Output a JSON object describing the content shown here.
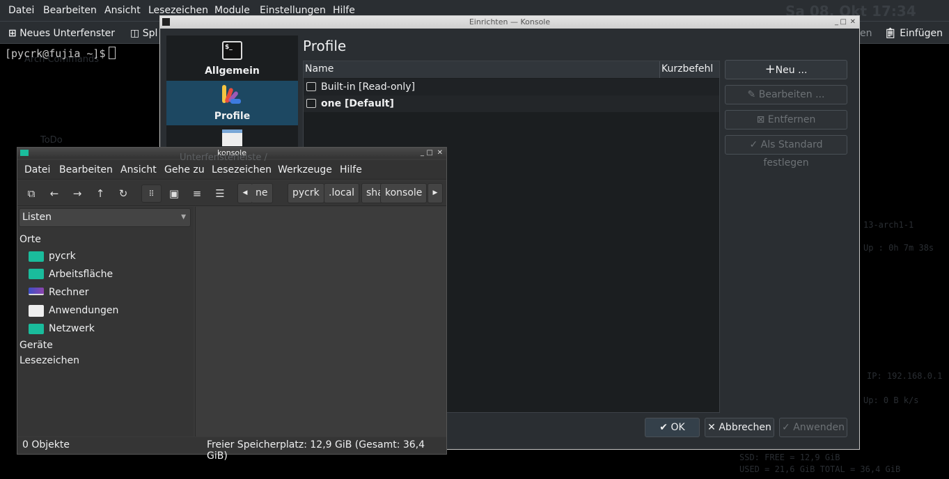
{
  "desktop": {
    "icons": [
      "Arch Commands",
      "ToDo",
      "Unterfensterleiste /"
    ],
    "conky": {
      "clock": "Sa 08. Okt 17:34",
      "kernel": "13-arch1-1",
      "uptime": "Up : 0h 7m 38s",
      "ip": "IP: 192.168.0.1",
      "net_up": "Up: 0 B k/s",
      "ssd_free": "SSD:    FREE = 12,9 GiB",
      "ssd_used": "USED = 21,6 GiB    TOTAL = 36,4 GiB"
    }
  },
  "konsole": {
    "menu": [
      "Datei",
      "Bearbeiten",
      "Ansicht",
      "Lesezeichen",
      "Module",
      "Einstellungen",
      "Hilfe"
    ],
    "toolbar": {
      "new_tab": "Neues Unterfenster",
      "split": "Spl",
      "copy_partial": "en",
      "paste": "Einfügen"
    },
    "prompt": "[pycrk@fujia ~]$"
  },
  "dialog": {
    "title": "Einrichten — Konsole",
    "sidebar": [
      {
        "label": "Allgemein",
        "icon": "terminal-icon"
      },
      {
        "label": "Profile",
        "icon": "profile-icon",
        "selected": true
      },
      {
        "label": "",
        "icon": "window-icon"
      }
    ],
    "heading": "Profile",
    "table": {
      "columns": [
        "Name",
        "Kurzbefehl"
      ],
      "rows": [
        {
          "name": "Built-in [Read-only]",
          "bold": false
        },
        {
          "name": "one [Default]",
          "bold": true
        }
      ]
    },
    "buttons": {
      "new": "Neu ...",
      "edit": "Bearbeiten ...",
      "remove": "Entfernen",
      "default": "Als Standard festlegen"
    },
    "footer": {
      "ok": "OK",
      "cancel": "Abbrechen",
      "apply": "Anwenden"
    }
  },
  "filemanager": {
    "title": "konsole",
    "menu": [
      "Datei",
      "Bearbeiten",
      "Ansicht",
      "Gehe zu",
      "Lesezeichen",
      "Werkzeuge",
      "Hilfe"
    ],
    "breadcrumb": [
      "ne",
      "pycrk",
      ".local",
      "share",
      "konsole"
    ],
    "side_combo": "Listen",
    "sections": {
      "places": "Orte",
      "devices": "Geräte",
      "bookmarks": "Lesezeichen"
    },
    "places": [
      {
        "label": "pycrk",
        "icon": "home-folder-icon"
      },
      {
        "label": "Arbeitsfläche",
        "icon": "desktop-folder-icon"
      },
      {
        "label": "Rechner",
        "icon": "computer-icon"
      },
      {
        "label": "Anwendungen",
        "icon": "applications-icon"
      },
      {
        "label": "Netzwerk",
        "icon": "network-folder-icon"
      }
    ],
    "status": {
      "count": "0 Objekte",
      "free": "Freier Speicherplatz: 12,9 GiB (Gesamt: 36,4 GiB)"
    }
  },
  "colors": {
    "accent": "#1d4862",
    "folder": "#1abc9c"
  }
}
